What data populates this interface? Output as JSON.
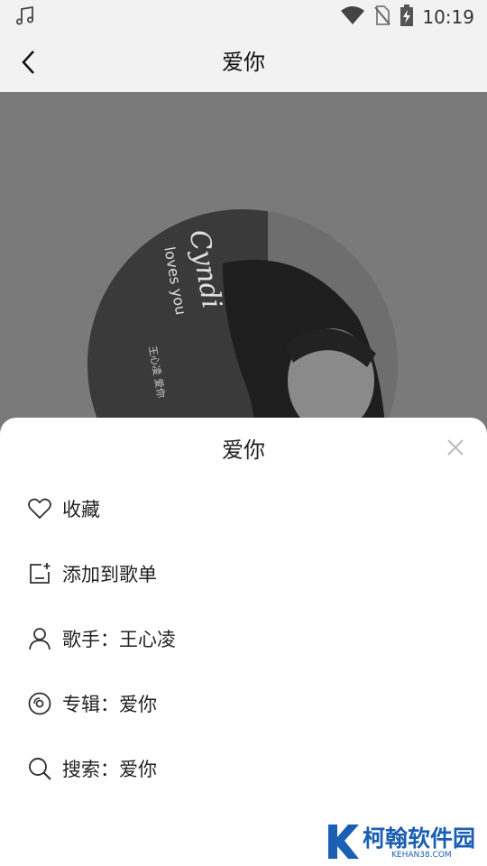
{
  "statusbar": {
    "time": "10:19",
    "icons": [
      "music-note-icon",
      "wifi-icon",
      "no-sim-icon",
      "battery-charging-icon"
    ]
  },
  "header": {
    "title": "爱你",
    "back_icon": "chevron-left-icon"
  },
  "player": {
    "cover_text_1": "Cyndi",
    "cover_text_2": "loves you",
    "cover_text_3": "王心凌 爱你"
  },
  "sheet": {
    "title": "爱你",
    "close_icon": "close-icon",
    "items": [
      {
        "label": "收藏",
        "icon": "heart-icon"
      },
      {
        "label": "添加到歌单",
        "icon": "add-to-playlist-icon"
      },
      {
        "label": "歌手：王心凌",
        "icon": "person-icon"
      },
      {
        "label": "专辑：爱你",
        "icon": "album-disc-icon"
      },
      {
        "label": "搜索：爱你",
        "icon": "search-icon"
      }
    ]
  },
  "watermark": {
    "name": "柯翰软件园",
    "domain": "KEHAN38.COM"
  }
}
